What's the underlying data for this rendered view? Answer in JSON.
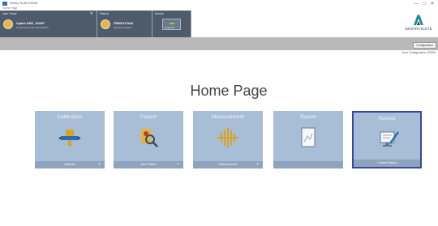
{
  "titlebar": {
    "title": "Sentry Suite ESDM",
    "subtitle": "Home Page",
    "minimize": "—",
    "maximize": "□",
    "close": "✕"
  },
  "header": {
    "user_panel": {
      "label": "User Panel",
      "close": "✕",
      "name": "Vyaire ESD_2020F",
      "sub": "Local Sentrysuite Workstation"
    },
    "patient_panel": {
      "label": "Patient",
      "name": "ZRM1372344",
      "sub": "Synthetic Patient"
    },
    "status_panel": {
      "label": "Device",
      "status": "Connected"
    },
    "logo_text": "SENTRYSUITE"
  },
  "toolbar": {
    "config_button": "Configuration",
    "user_config": "User Configuration: ESDM"
  },
  "home": {
    "title": "Home Page",
    "tiles": [
      {
        "label": "Calibration",
        "footer": "Calibrate",
        "plus": "+",
        "icon": "calibration-icon"
      },
      {
        "label": "Patient",
        "footer": "New Patient",
        "plus": "+",
        "icon": "patient-search-icon"
      },
      {
        "label": "Measurement",
        "footer": "Measurements",
        "plus": "+",
        "icon": "measurement-wave-icon"
      },
      {
        "label": "Report",
        "footer": "",
        "plus": "",
        "icon": "report-icon"
      },
      {
        "label": "Review",
        "footer": "Current Patient",
        "plus": "",
        "icon": "review-edit-icon"
      }
    ]
  },
  "colors": {
    "tile": "#a8bdd6",
    "tile_footer": "#8ea3bd",
    "selected_border": "#3549a3",
    "header_panel": "#4d5b6b",
    "toolbar": "#b9b9b9"
  }
}
